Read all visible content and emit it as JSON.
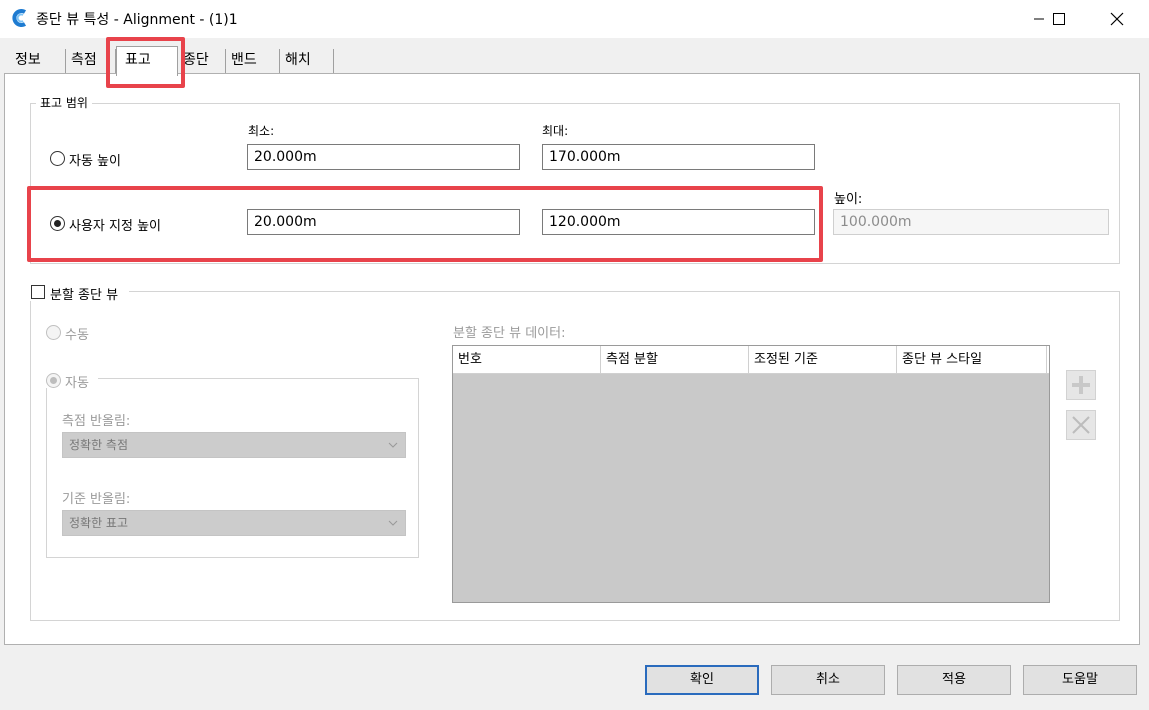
{
  "window": {
    "title": "종단 뷰 특성 - Alignment - (1)1",
    "minimize_icon": "minimize-icon",
    "maximize_icon": "maximize-icon",
    "close_icon": "close-icon"
  },
  "tabs": [
    {
      "label": "정보"
    },
    {
      "label": "측점"
    },
    {
      "label": "표고",
      "active": true
    },
    {
      "label": "종단"
    },
    {
      "label": "밴드"
    },
    {
      "label": "해치"
    }
  ],
  "elevation_range": {
    "group_title": "표고 범위",
    "min_label": "최소:",
    "max_label": "최대:",
    "height_label": "높이:",
    "auto_height": {
      "label": "자동 높이",
      "selected": false,
      "min": "20.000m",
      "max": "170.000m"
    },
    "user_height": {
      "label": "사용자 지정 높이",
      "selected": true,
      "min": "20.000m",
      "max": "120.000m",
      "height": "100.000m"
    }
  },
  "split_profile": {
    "checkbox_label": "분할 종단 뷰",
    "checked": false,
    "manual_label": "수동",
    "auto_label": "자동",
    "station_rounding_label": "측점 반올림:",
    "station_rounding_value": "정확한 측점",
    "datum_rounding_label": "기준 반올림:",
    "datum_rounding_value": "정확한 표고",
    "data_label": "분할 종단 뷰 데이터:",
    "columns": [
      "번호",
      "측점 분할",
      "조정된 기준",
      "종단 뷰 스타일"
    ],
    "rows": []
  },
  "buttons": {
    "ok": "확인",
    "cancel": "취소",
    "apply": "적용",
    "help": "도움말"
  },
  "colors": {
    "highlight": "#e8434b",
    "default_button_border": "#2a6bbd",
    "app_icon": "#1e7bd1"
  }
}
